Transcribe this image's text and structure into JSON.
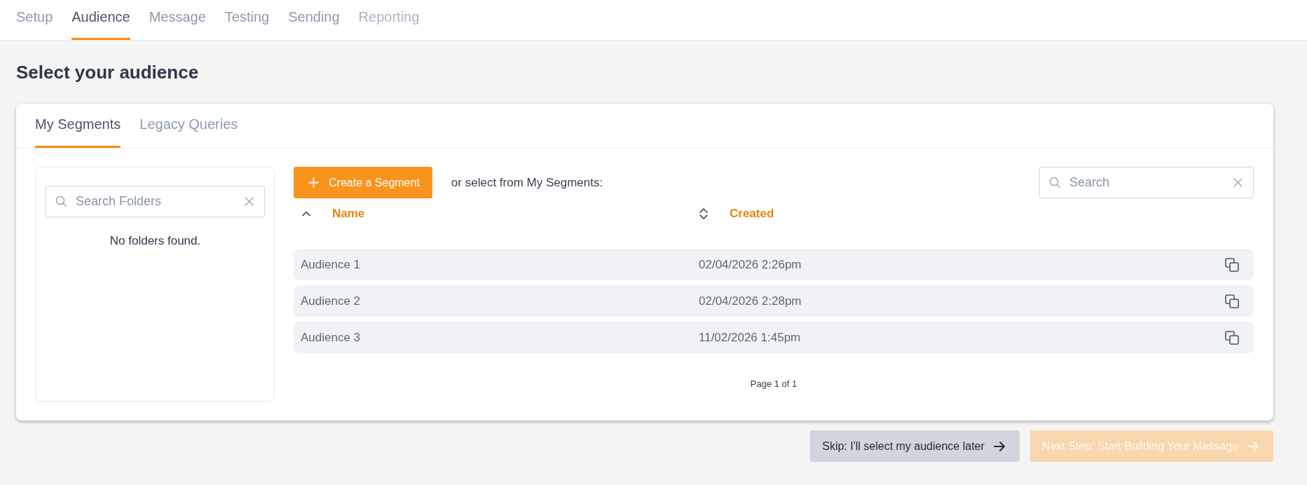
{
  "steps": [
    {
      "label": "Setup",
      "selected": false,
      "disabled": false
    },
    {
      "label": "Audience",
      "selected": true,
      "disabled": false
    },
    {
      "label": "Message",
      "selected": false,
      "disabled": false
    },
    {
      "label": "Testing",
      "selected": false,
      "disabled": false
    },
    {
      "label": "Sending",
      "selected": false,
      "disabled": false
    },
    {
      "label": "Reporting",
      "selected": false,
      "disabled": true
    }
  ],
  "heading": "Select your audience",
  "tabs": [
    {
      "label": "My Segments",
      "selected": true
    },
    {
      "label": "Legacy Queries",
      "selected": false
    }
  ],
  "folders": {
    "search": {
      "placeholder": "Search Folders"
    },
    "empty_message": "No folders found."
  },
  "segments": {
    "create_button": "Create a Segment",
    "prompt": "or select from My Segments:",
    "search": {
      "placeholder": "Search"
    },
    "columns": [
      {
        "label": "Name",
        "sorted": true
      },
      {
        "label": "Created",
        "sorted": false
      }
    ],
    "rows": [
      {
        "name": "Audience 1",
        "created": "02/04/2026 2:26pm"
      },
      {
        "name": "Audience 2",
        "created": "02/04/2026 2:28pm"
      },
      {
        "name": "Audience 3",
        "created": "11/02/2026 1:45pm"
      }
    ],
    "pagination": "Page 1 of 1"
  },
  "actions": [
    {
      "label": "Skip: I'll select my audience later",
      "kind": "secondary",
      "disabled": false
    },
    {
      "label": "Next Step: Start Building Your Message",
      "kind": "primary",
      "disabled": true
    }
  ]
}
